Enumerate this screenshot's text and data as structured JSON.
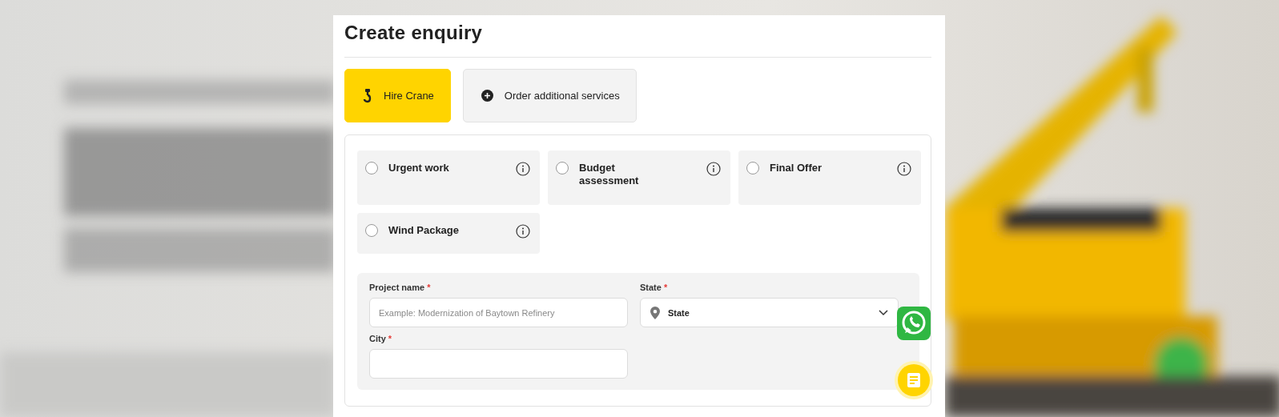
{
  "dialog": {
    "title": "Create enquiry"
  },
  "tabs": [
    {
      "label": "Hire Crane",
      "selected": true,
      "kind": "hook"
    },
    {
      "label": "Order additional services",
      "selected": false,
      "kind": "plus"
    }
  ],
  "options": [
    {
      "label": "Urgent work",
      "checked": false
    },
    {
      "label": "Budget assessment",
      "checked": false
    },
    {
      "label": "Final Offer",
      "checked": false
    },
    {
      "label": "Wind Package",
      "checked": false
    }
  ],
  "form": {
    "fields": [
      {
        "kind": "text",
        "label": "Project name",
        "required_mark": "*",
        "placeholder": "Example: Modernization of Baytown Refinery"
      },
      {
        "kind": "select",
        "label": "State",
        "required_mark": "*",
        "value": "State"
      },
      {
        "kind": "text",
        "label": "City",
        "required_mark": "*"
      }
    ]
  }
}
